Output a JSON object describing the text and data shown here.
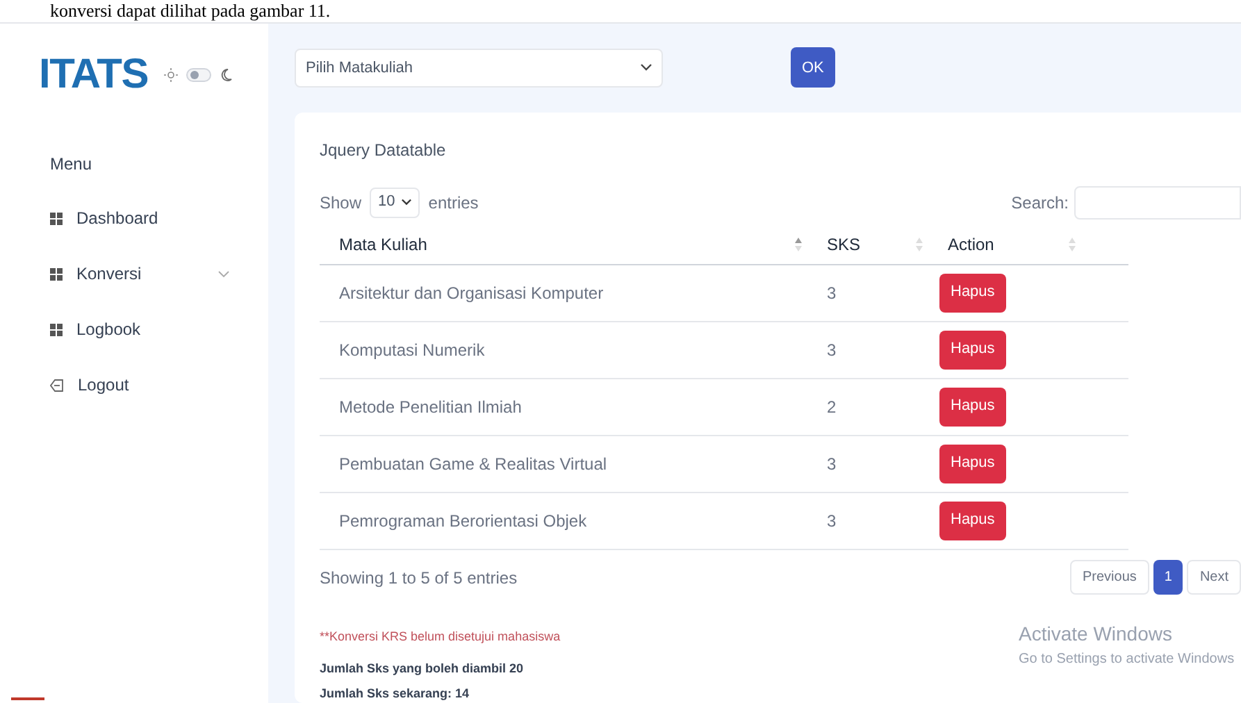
{
  "document_text": "konversi dapat dilihat pada gambar 11.",
  "sidebar": {
    "logo": "ITATS",
    "theme_toggle": {
      "on": false
    },
    "menu_heading": "Menu",
    "items": [
      {
        "label": "Dashboard",
        "kind": "grid",
        "expandable": false
      },
      {
        "label": "Konversi",
        "kind": "grid",
        "expandable": true
      },
      {
        "label": "Logbook",
        "kind": "grid",
        "expandable": false
      },
      {
        "label": "Logout",
        "kind": "logout",
        "expandable": false
      }
    ]
  },
  "course_select": {
    "placeholder": "Pilih Matakuliah"
  },
  "ok_button": "OK",
  "card": {
    "title": "Jquery Datatable",
    "show_label": "Show",
    "page_size": "10",
    "entries_label": "entries",
    "search_label": "Search:",
    "columns": [
      "Mata Kuliah",
      "SKS",
      "Action"
    ],
    "rows": [
      {
        "name": "Arsitektur dan Organisasi Komputer",
        "sks": "3",
        "action": "Hapus"
      },
      {
        "name": "Komputasi Numerik",
        "sks": "3",
        "action": "Hapus"
      },
      {
        "name": "Metode Penelitian Ilmiah",
        "sks": "2",
        "action": "Hapus"
      },
      {
        "name": "Pembuatan Game & Realitas Virtual",
        "sks": "3",
        "action": "Hapus"
      },
      {
        "name": "Pemrograman Berorientasi Objek",
        "sks": "3",
        "action": "Hapus"
      }
    ],
    "info": "Showing 1 to 5 of 5 entries",
    "pagination": [
      {
        "label": "Previous",
        "selected": false
      },
      {
        "label": "1",
        "selected": true
      },
      {
        "label": "Next",
        "selected": false
      }
    ],
    "warning": "**Konversi KRS belum disetujui mahasiswa",
    "notes": [
      "Jumlah Sks yang boleh diambil 20",
      "Jumlah Sks sekarang: 14"
    ]
  },
  "os_notice": {
    "title": "Activate Windows",
    "subtitle": "Go to Settings to activate Windows"
  }
}
